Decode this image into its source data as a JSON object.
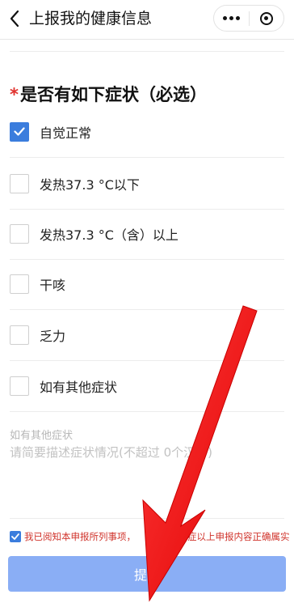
{
  "navbar": {
    "title": "上报我的健康信息",
    "back_icon": "chevron-left-icon",
    "more_icon": "more-dots-icon",
    "close_icon": "target-icon"
  },
  "question": {
    "required_mark": "*",
    "title": "是否有如下症状（必选）"
  },
  "options": [
    {
      "label": "自觉正常",
      "checked": true
    },
    {
      "label": "发热37.3 °C以下",
      "checked": false
    },
    {
      "label": "发热37.3 °C（含）以上",
      "checked": false
    },
    {
      "label": "干咳",
      "checked": false
    },
    {
      "label": "乏力",
      "checked": false
    },
    {
      "label": "如有其他症状",
      "checked": false
    }
  ],
  "other": {
    "label": "如有其他症状",
    "placeholder": "请简要描述症状情况(不超过 0个汉字)"
  },
  "agreement": {
    "checked": true,
    "text": "我已阅知本申报所列事项，",
    "text_tail": "症以上申报内容正确属实"
  },
  "submit": {
    "label": "提交"
  },
  "colors": {
    "accent": "#3b7ddd",
    "required": "#e0312d",
    "submit_bg": "#8aaef5",
    "agreement_text": "#d0342c",
    "annotation_arrow": "#ff1a1a"
  }
}
